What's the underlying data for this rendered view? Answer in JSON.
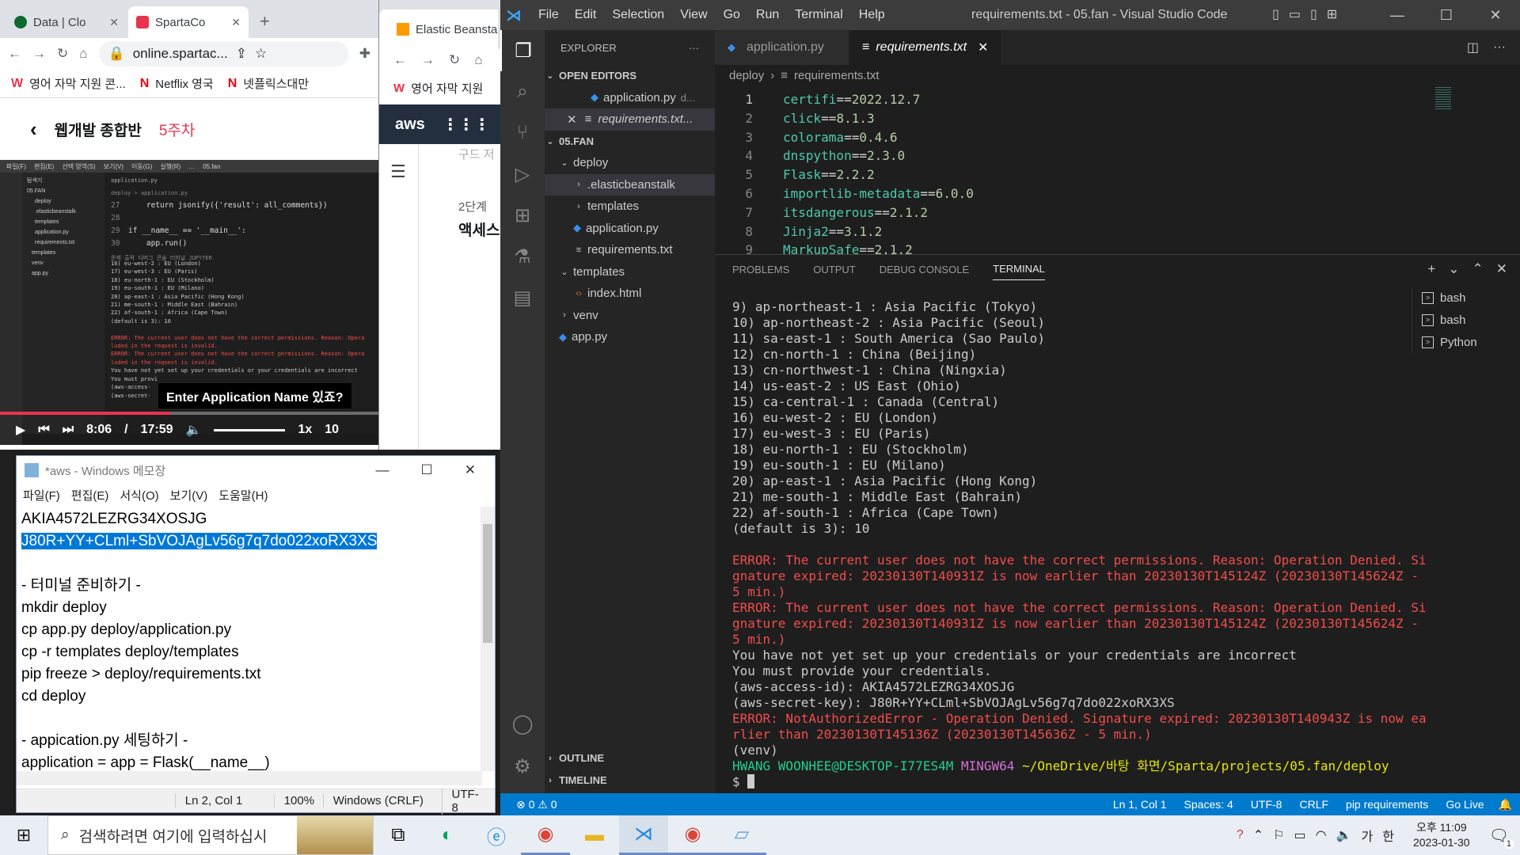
{
  "chrome1": {
    "tabs": [
      {
        "label": "Data | Clo",
        "close": "✕"
      },
      {
        "label": "SpartaCo",
        "close": "✕"
      }
    ],
    "new_tab": "+",
    "url": "online.spartac...",
    "bookmarks": [
      {
        "icon": "W",
        "label": "영어 자막 지원 콘..."
      },
      {
        "icon": "N",
        "label": "Netflix 영국"
      },
      {
        "icon": "N",
        "label": "넷플릭스대만"
      }
    ],
    "course_title": "웹개발 종합반",
    "course_week": "5주차",
    "video": {
      "menu": [
        "파일(F)",
        "편집(E)",
        "선택 영역(S)",
        "보기(V)",
        "이동(G)",
        "실행(R)",
        "…",
        "05.fan"
      ],
      "explorer_items": [
        "탐색기",
        "05.FAN",
        "deploy",
        ".elasticbeanstalk",
        "templates",
        "application.py",
        "requirements.txt",
        "templates",
        "venv",
        "app.py"
      ],
      "editor_tab": "application.py",
      "crumbs": "deploy > application.py",
      "code_lines": [
        {
          "n": "27",
          "t": "    return jsonify({'result': all_comments})"
        },
        {
          "n": "28",
          "t": ""
        },
        {
          "n": "29",
          "t": "if __name__ == '__main__':"
        },
        {
          "n": "30",
          "t": "    app.run()"
        }
      ],
      "panel_tabs": "문제   출력   디버그 콘솔   터미널   JUPYTER",
      "term_lines": [
        "16) eu-west-2 : EU (London)",
        "17) eu-west-3 : EU (Paris)",
        "18) eu-north-1 : EU (Stockholm)",
        "19) eu-south-1 : EU (Milano)",
        "20) ap-east-1 : Asia Pacific (Hong Kong)",
        "21) me-south-1 : Middle East (Bahrain)",
        "22) af-south-1 : Africa (Cape Town)",
        "(default is 3): 10"
      ],
      "term_errors": [
        "ERROR: The current user does not have the correct permissions. Reason: Opera",
        "luded in the request is invalid.",
        "ERROR: The current user does not have the correct permissions. Reason: Opera",
        "luded in the request is invalid."
      ],
      "term_tail": [
        "You have not yet set up your credentials or your credentials are incorrect",
        "You must provi",
        "(aws-access-",
        "(aws-secret-"
      ],
      "caption": "Enter Application Name 있죠?",
      "current_time": "8:06",
      "separator": "/",
      "duration": "17:59",
      "speed": "1x",
      "skip": "10",
      "progress": 0.45
    }
  },
  "chrome2": {
    "tab_label": "Elastic Beansta",
    "bookmark": "영어 자막 지원",
    "aws_logo": "aws",
    "service_label": "서",
    "step_label": "2단계",
    "step_title": "액세스",
    "faded_text": "구드 저"
  },
  "notepad": {
    "title": "*aws - Windows 메모장",
    "menu": [
      "파일(F)",
      "편집(E)",
      "서식(O)",
      "보기(V)",
      "도움말(H)"
    ],
    "lines": [
      "AKIA4572LEZRG34XOSJG",
      "J80R+YY+CLml+SbVOJAgLv56g7q7do022xoRX3XS",
      "",
      "- 터미널 준비하기 -",
      "mkdir deploy",
      "cp app.py deploy/application.py",
      "cp -r templates deploy/templates",
      "pip freeze > deploy/requirements.txt",
      "cd deploy",
      "",
      "- appication.py 세팅하기 -",
      "application = app = Flask(__name__)"
    ],
    "selected_line": 1,
    "status": {
      "position": "Ln 2, Col 1",
      "zoom": "100%",
      "eol": "Windows (CRLF)",
      "encoding": "UTF-8"
    }
  },
  "vscode": {
    "window_title": "requirements.txt - 05.fan - Visual Studio Code",
    "menu": [
      "File",
      "Edit",
      "Selection",
      "View",
      "Go",
      "Run",
      "Terminal",
      "Help"
    ],
    "explorer_header": "EXPLORER",
    "open_editors_header": "OPEN EDITORS",
    "open_editors": [
      {
        "name": "application.py",
        "desc": "d..."
      },
      {
        "name": "requirements.txt...",
        "desc": ""
      }
    ],
    "folder_header": "05.FAN",
    "tree": [
      {
        "label": "deploy",
        "indent": 1,
        "chevron": "⌄"
      },
      {
        "label": ".elasticbeanstalk",
        "indent": 2,
        "chevron": "›"
      },
      {
        "label": "templates",
        "indent": 2,
        "chevron": "›"
      },
      {
        "label": "application.py",
        "indent": 2,
        "chevron": "py"
      },
      {
        "label": "requirements.txt",
        "indent": 2,
        "chevron": "≡"
      },
      {
        "label": "templates",
        "indent": 1,
        "chevron": "⌄"
      },
      {
        "label": "index.html",
        "indent": 2,
        "chevron": "<>"
      },
      {
        "label": "venv",
        "indent": 1,
        "chevron": "›"
      },
      {
        "label": "app.py",
        "indent": 1,
        "chevron": "py"
      }
    ],
    "outline": "OUTLINE",
    "timeline": "TIMELINE",
    "editor_tabs": [
      {
        "label": "application.py",
        "active": false
      },
      {
        "label": "requirements.txt",
        "active": true
      }
    ],
    "breadcrumb": [
      "deploy",
      "requirements.txt"
    ],
    "code": [
      {
        "n": "1",
        "pkg": "certifi",
        "ver": "2022.12.7"
      },
      {
        "n": "2",
        "pkg": "click",
        "ver": "8.1.3"
      },
      {
        "n": "3",
        "pkg": "colorama",
        "ver": "0.4.6"
      },
      {
        "n": "4",
        "pkg": "dnspython",
        "ver": "2.3.0"
      },
      {
        "n": "5",
        "pkg": "Flask",
        "ver": "2.2.2"
      },
      {
        "n": "6",
        "pkg": "importlib-metadata",
        "ver": "6.0.0"
      },
      {
        "n": "7",
        "pkg": "itsdangerous",
        "ver": "2.1.2"
      },
      {
        "n": "8",
        "pkg": "Jinja2",
        "ver": "3.1.2"
      },
      {
        "n": "9",
        "pkg": "MarkupSafe",
        "ver": "2.1.2"
      }
    ],
    "panel_tabs": [
      "PROBLEMS",
      "OUTPUT",
      "DEBUG CONSOLE",
      "TERMINAL"
    ],
    "terminal_lines": [
      {
        "c": "",
        "t": "9) ap-northeast-1 : Asia Pacific (Tokyo)"
      },
      {
        "c": "",
        "t": "10) ap-northeast-2 : Asia Pacific (Seoul)"
      },
      {
        "c": "",
        "t": "11) sa-east-1 : South America (Sao Paulo)"
      },
      {
        "c": "",
        "t": "12) cn-north-1 : China (Beijing)"
      },
      {
        "c": "",
        "t": "13) cn-northwest-1 : China (Ningxia)"
      },
      {
        "c": "",
        "t": "14) us-east-2 : US East (Ohio)"
      },
      {
        "c": "",
        "t": "15) ca-central-1 : Canada (Central)"
      },
      {
        "c": "",
        "t": "16) eu-west-2 : EU (London)"
      },
      {
        "c": "",
        "t": "17) eu-west-3 : EU (Paris)"
      },
      {
        "c": "",
        "t": "18) eu-north-1 : EU (Stockholm)"
      },
      {
        "c": "",
        "t": "19) eu-south-1 : EU (Milano)"
      },
      {
        "c": "",
        "t": "20) ap-east-1 : Asia Pacific (Hong Kong)"
      },
      {
        "c": "",
        "t": "21) me-south-1 : Middle East (Bahrain)"
      },
      {
        "c": "",
        "t": "22) af-south-1 : Africa (Cape Town)"
      },
      {
        "c": "",
        "t": "(default is 3): 10"
      },
      {
        "c": "",
        "t": ""
      },
      {
        "c": "r",
        "t": "ERROR: The current user does not have the correct permissions. Reason: Operation Denied. Si"
      },
      {
        "c": "r",
        "t": "gnature expired: 20230130T140931Z is now earlier than 20230130T145124Z (20230130T145624Z -"
      },
      {
        "c": "r",
        "t": "5 min.)"
      },
      {
        "c": "r",
        "t": "ERROR: The current user does not have the correct permissions. Reason: Operation Denied. Si"
      },
      {
        "c": "r",
        "t": "gnature expired: 20230130T140931Z is now earlier than 20230130T145124Z (20230130T145624Z -"
      },
      {
        "c": "r",
        "t": "5 min.)"
      },
      {
        "c": "",
        "t": "You have not yet set up your credentials or your credentials are incorrect"
      },
      {
        "c": "",
        "t": "You must provide your credentials."
      },
      {
        "c": "",
        "t": "(aws-access-id): AKIA4572LEZRG34XOSJG"
      },
      {
        "c": "",
        "t": "(aws-secret-key): J80R+YY+CLml+SbVOJAgLv56g7q7do022xoRX3XS"
      },
      {
        "c": "r",
        "t": "ERROR: NotAuthorizedError - Operation Denied. Signature expired: 20230130T140943Z is now ea"
      },
      {
        "c": "r",
        "t": "rlier than 20230130T145136Z (20230130T145636Z - 5 min.)"
      },
      {
        "c": "",
        "t": "(venv)"
      }
    ],
    "prompt": {
      "user": "HWANG WOONHEE@DESKTOP-I77ES4M",
      "shell": "MINGW64",
      "path": "~/OneDrive/바탕 화면/Sparta/projects/05.fan/deploy",
      "symbol": "$"
    },
    "terminals": [
      "bash",
      "bash",
      "Python"
    ],
    "status_left": "⊗ 0 ⚠ 0",
    "status_right": [
      "Ln 1, Col 1",
      "Spaces: 4",
      "UTF-8",
      "CRLF",
      "pip requirements",
      "Go Live"
    ]
  },
  "taskbar": {
    "search_placeholder": "검색하려면 여기에 입력하십시",
    "ime_mode": "가",
    "ime_lang": "한",
    "time_period": "오후 11:09",
    "date": "2023-01-30",
    "notif_count": "1"
  },
  "colors": {
    "accent": "#007acc",
    "error": "#f14c4c",
    "selection": "#0078d7",
    "sparta_red": "#e8344e"
  }
}
